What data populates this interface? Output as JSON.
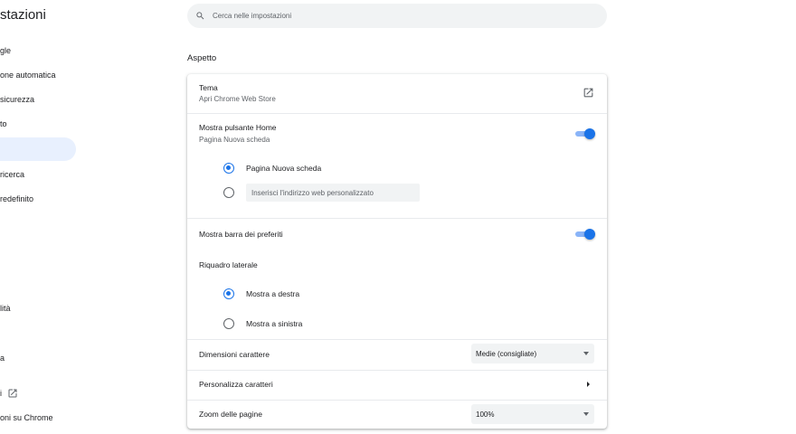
{
  "header": {
    "title": "stazioni",
    "search_placeholder": "Cerca nelle impostazioni"
  },
  "sidebar": {
    "items": [
      {
        "label": "gle"
      },
      {
        "label": "one automatica"
      },
      {
        "label": "sicurezza"
      },
      {
        "label": "to"
      },
      {
        "label": ""
      },
      {
        "label": "ricerca"
      },
      {
        "label": "redefinito"
      },
      {
        "label": "lità"
      },
      {
        "label": "a"
      },
      {
        "label": "i"
      },
      {
        "label": "oni su Chrome"
      }
    ]
  },
  "appearance": {
    "section_title": "Aspetto",
    "theme": {
      "label": "Tema",
      "sublabel": "Apri Chrome Web Store"
    },
    "home_button": {
      "label": "Mostra pulsante Home",
      "sublabel": "Pagina Nuova scheda",
      "enabled": true,
      "option_new_tab": "Pagina Nuova scheda",
      "custom_url_placeholder": "Inserisci l'indirizzo web personalizzato"
    },
    "bookmarks_bar": {
      "label": "Mostra barra dei preferiti",
      "enabled": true
    },
    "side_panel": {
      "label": "Riquadro laterale",
      "option_right": "Mostra a destra",
      "option_left": "Mostra a sinistra"
    },
    "font_size": {
      "label": "Dimensioni carattere",
      "value": "Medie (consigliate)"
    },
    "customize_fonts": {
      "label": "Personalizza caratteri"
    },
    "page_zoom": {
      "label": "Zoom delle pagine",
      "value": "100%"
    }
  },
  "colors": {
    "accent": "#1a73e8",
    "accent_light": "#8ab4f8",
    "active_nav_bg": "#e8f0fe",
    "field_bg": "#f1f3f4"
  },
  "icons": [
    "search-icon",
    "open-in-new-icon",
    "chevron-down-icon",
    "chevron-right-icon"
  ]
}
